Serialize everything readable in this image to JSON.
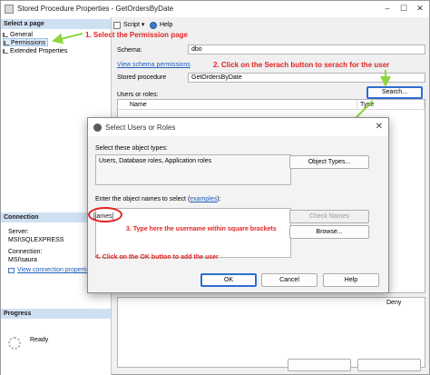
{
  "window": {
    "title": "Stored Procedure Properties - GetOrdersByDate",
    "min_glyph": "–",
    "max_glyph": "☐",
    "close_glyph": "✕"
  },
  "left_panel": {
    "select_page_header": "Select a page",
    "pages": [
      {
        "label": "General",
        "icon": "properties-icon"
      },
      {
        "label": "Permissions",
        "icon": "properties-icon"
      },
      {
        "label": "Extended Properties",
        "icon": "properties-icon"
      }
    ],
    "connection_header": "Connection",
    "server_label": "Server:",
    "server_value": "MSI\\SQLEXPRESS",
    "connection_label": "Connection:",
    "connection_value": "MSI\\saura",
    "view_connection_link": "View connection properties",
    "progress_header": "Progress",
    "progress_status": "Ready"
  },
  "toolbar": {
    "script_label": "Script",
    "script_dropdown": "▾",
    "help_label": "Help"
  },
  "main": {
    "schema_label": "Schema:",
    "schema_value": "dbo",
    "view_schema_permissions_link": "View schema permissions",
    "stored_procedure_label": "Stored procedure",
    "stored_procedure_value": "GetOrdersByDate",
    "users_roles_label": "Users or roles:",
    "search_button": "Search...",
    "columns": [
      "Name",
      "Type"
    ],
    "permissions_deny_header": "Deny"
  },
  "dialog": {
    "title": "Select Users or Roles",
    "close_glyph": "✕",
    "object_types_label": "Select these object types:",
    "object_types_value": "Users, Database roles, Application roles",
    "object_types_button": "Object Types...",
    "enter_names_prefix": "Enter the object names to select (",
    "enter_names_link": "examples",
    "enter_names_suffix": "):",
    "names_value": "[james]",
    "check_names_button": "Check Names",
    "browse_button": "Browse...",
    "ok_button": "OK",
    "cancel_button": "Cancel",
    "help_button": "Help"
  },
  "annotations": {
    "step1": "1. Select the Permission page",
    "step2": "2. Click on the Serach button to serach for the user",
    "step3": "3. Type here the username within square brackets",
    "step4": "4. Click on the OK button to add the user",
    "color": "#e52323",
    "arrow_color": "#8dd63d"
  },
  "colors": {
    "section_header_bg": "#cfe0f3",
    "link": "#1e5dbb",
    "primary_button_border": "#2d6dd1"
  }
}
